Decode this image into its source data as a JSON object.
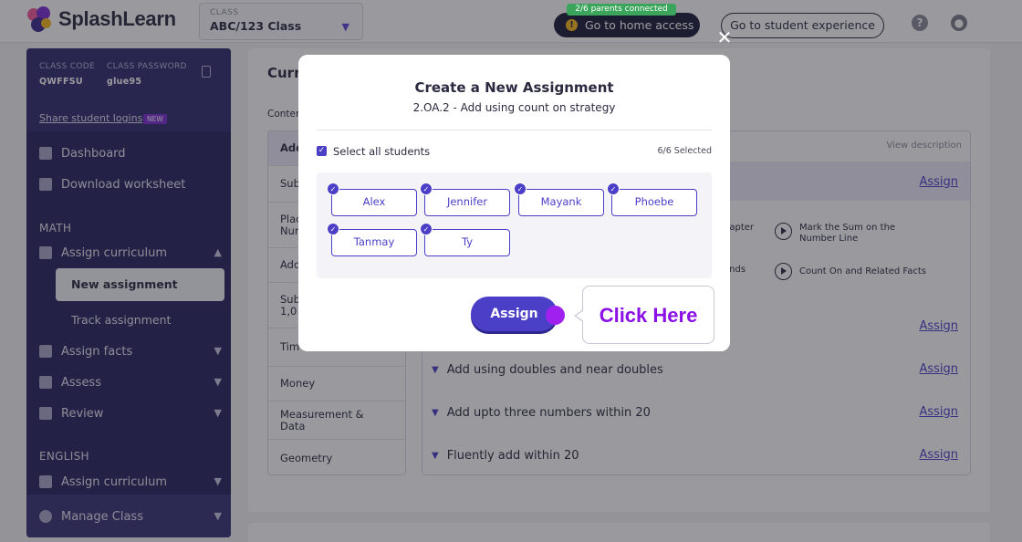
{
  "header": {
    "logo_text": "SplashLearn",
    "class_caption": "CLASS",
    "class_value": "ABC/123 Class",
    "parents_connected": "2/6 parents connected",
    "home_access": "Go to home access",
    "student_experience": "Go to student experience"
  },
  "sidebar": {
    "class_code_label": "CLASS CODE",
    "class_code": "QWFFSU",
    "class_password_label": "CLASS PASSWORD",
    "class_password": "glue95",
    "share_logins": "Share student logins",
    "new_tag": "NEW",
    "dashboard": "Dashboard",
    "download_worksheet": "Download worksheet",
    "math_head": "MATH",
    "assign_curriculum": "Assign curriculum",
    "new_assignment": "New assignment",
    "track_assignment": "Track assignment",
    "assign_facts": "Assign facts",
    "assess": "Assess",
    "review": "Review",
    "english_head": "ENGLISH",
    "assign_curriculum_eng": "Assign curriculum",
    "manage_class": "Manage Class"
  },
  "main": {
    "title": "Curr",
    "content_label": "Conter",
    "categories": [
      "Add",
      "Sub",
      "Plac\nNum",
      "Add",
      "Sub\n1,0",
      "Tim",
      "Money",
      "Measurement &\nData",
      "Geometry"
    ],
    "view_description": "View description",
    "assign_label": "Assign",
    "videos": [
      {
        "title": "hapter"
      },
      {
        "title": "Mark the Sum on the\nNumber Line"
      },
      {
        "title": "ends"
      },
      {
        "title": "Count On and Related Facts"
      }
    ],
    "topics": [
      "Add using doubles and near doubles",
      "Add upto three numbers within 20",
      "Fluently add within 20"
    ]
  },
  "modal": {
    "title": "Create a New Assignment",
    "subtitle": "2.OA.2 - Add using count on strategy",
    "select_all": "Select all students",
    "selected_count": "6/6 Selected",
    "students": [
      "Alex",
      "Jennifer",
      "Mayank",
      "Phoebe",
      "Tanmay",
      "Ty"
    ],
    "assign_button": "Assign",
    "callout": "Click Here"
  }
}
